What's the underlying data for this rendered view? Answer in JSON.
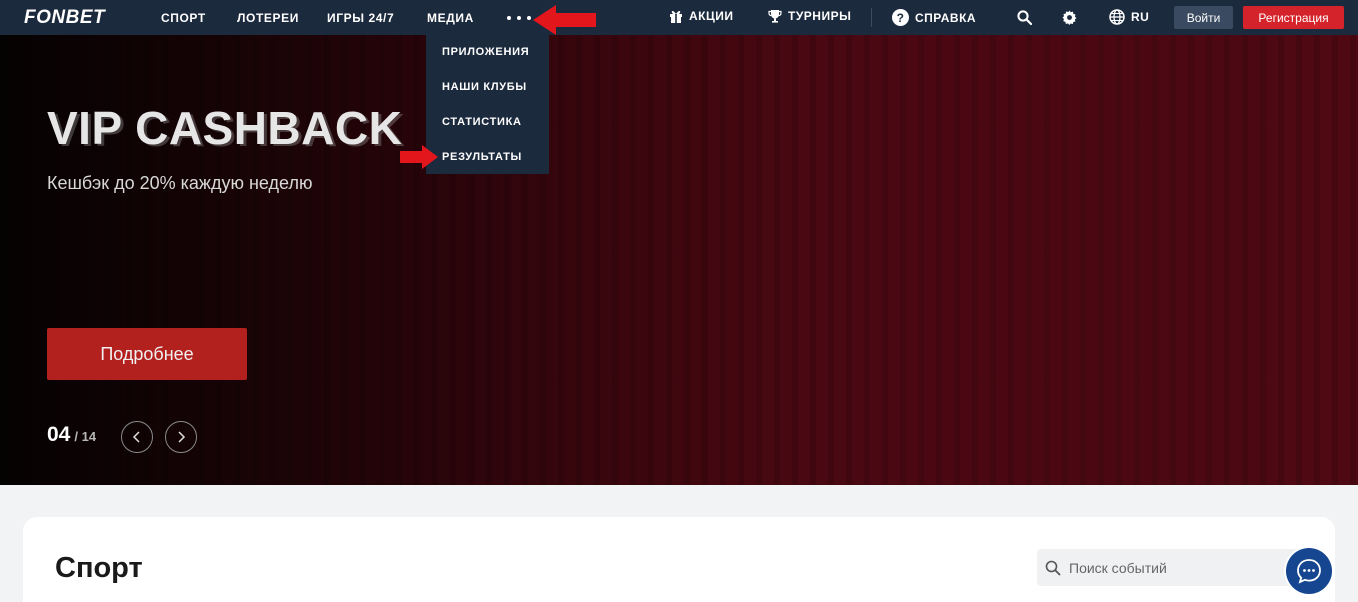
{
  "header": {
    "logo": "FONBET",
    "nav": [
      "СПОРТ",
      "ЛОТЕРЕИ",
      "ИГРЫ 24/7",
      "МЕДИА"
    ],
    "more_icon": "ellipsis-icon",
    "promos_label": "АКЦИИ",
    "tournaments_label": "ТУРНИРЫ",
    "help_label": "СПРАВКА",
    "language_label": "RU",
    "login_label": "Войти",
    "register_label": "Регистрация"
  },
  "dropdown": {
    "items": [
      "ПРИЛОЖЕНИЯ",
      "НАШИ КЛУБЫ",
      "СТАТИСТИКА",
      "РЕЗУЛЬТАТЫ"
    ]
  },
  "hero": {
    "title": "VIP CASHBACK",
    "subtitle": "Кешбэк до 20% каждую неделю",
    "button_label": "Подробнее",
    "current_slide": "04",
    "total_slides": "/ 14"
  },
  "sport": {
    "title": "Спорт",
    "search_placeholder": "Поиск событий"
  },
  "colors": {
    "nav_bg": "#1c2a3e",
    "brand_red": "#d4232a",
    "annotation_red": "#e3161c",
    "chat_blue": "#15468f"
  }
}
